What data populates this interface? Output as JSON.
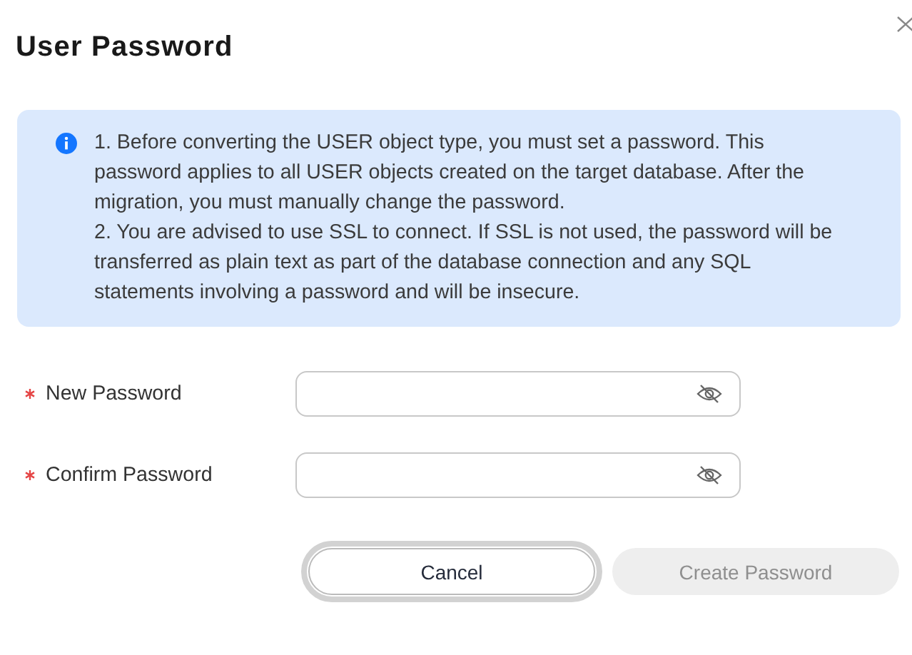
{
  "dialog": {
    "title": "User Password"
  },
  "notice": {
    "paragraphs": [
      "1. Before converting the USER object type, you must set a password. This password applies to all USER objects created on the target database. After the migration, you must manually change the password.",
      "2. You are advised to use SSL to connect. If SSL is not used, the password will be transferred as plain text as part of the database connection and any SQL statements involving a password and will be insecure."
    ]
  },
  "fields": [
    {
      "label": "New Password",
      "required": true
    },
    {
      "label": "Confirm Password",
      "required": true
    }
  ],
  "buttons": [
    {
      "label": "Cancel",
      "kind": "secondary",
      "focused": true,
      "disabled": false
    },
    {
      "label": "Create Password",
      "kind": "primary",
      "focused": false,
      "disabled": true
    }
  ]
}
